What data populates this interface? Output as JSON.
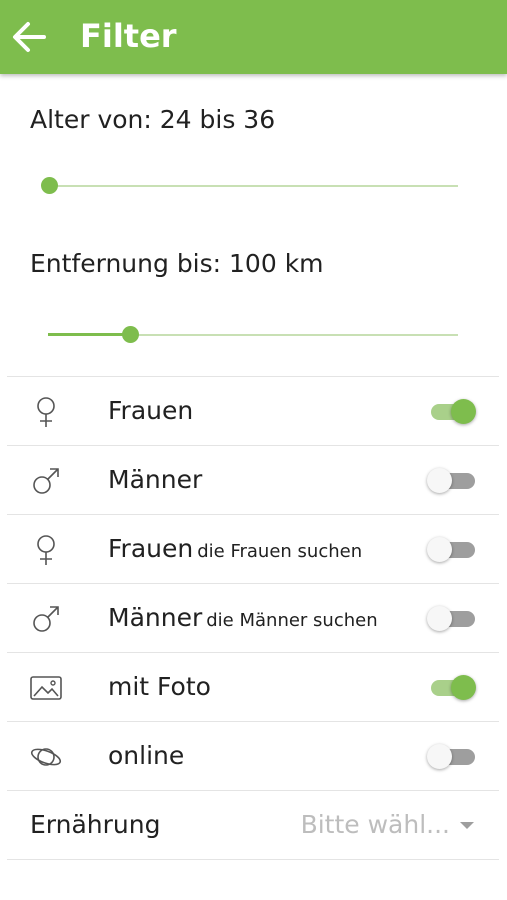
{
  "appbar": {
    "title": "Filter",
    "color": "#7ebd4d"
  },
  "age": {
    "label": "Alter von: 24 bis 36",
    "min_value": 24,
    "max_value": 36
  },
  "distance": {
    "label": "Entfernung bis: 100 km",
    "value": 100,
    "unit": "km"
  },
  "filters": [
    {
      "icon": "female-icon",
      "label": "Frauen",
      "sub": "",
      "on": true
    },
    {
      "icon": "male-icon",
      "label": "Männer",
      "sub": "",
      "on": false
    },
    {
      "icon": "female-icon",
      "label": "Frauen",
      "sub": "die Frauen suchen",
      "on": false
    },
    {
      "icon": "male-icon",
      "label": "Männer",
      "sub": "die Männer suchen",
      "on": false
    },
    {
      "icon": "photo-icon",
      "label": "mit Foto",
      "sub": "",
      "on": true
    },
    {
      "icon": "planet-icon",
      "label": "online",
      "sub": "",
      "on": false
    }
  ],
  "diet": {
    "label": "Ernährung",
    "placeholder": "Bitte wähl..."
  }
}
